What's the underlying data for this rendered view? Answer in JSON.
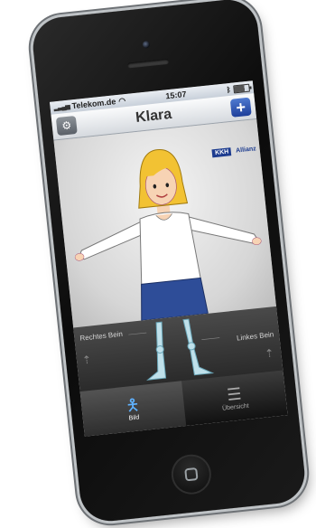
{
  "status_bar": {
    "carrier": "Telekom.de",
    "time": "15:07"
  },
  "nav_bar": {
    "title": "Klara"
  },
  "stage": {
    "brand_kkh": "KKH",
    "brand_allianz": "Allianz"
  },
  "legs_panel": {
    "right_leg_label": "Rechtes Bein",
    "left_leg_label": "Linkes Bein"
  },
  "tab_bar": {
    "tabs": [
      {
        "label": "Bild",
        "icon": "body-figure-icon",
        "active": true
      },
      {
        "label": "Übersicht",
        "icon": "list-icon",
        "active": false
      }
    ]
  },
  "colors": {
    "nav_add_button": "#1e3f9a",
    "tab_active_icon": "#5fb2ff",
    "shirt": "#ffffff",
    "skirt": "#2e4d98",
    "hair": "#f2c233"
  }
}
